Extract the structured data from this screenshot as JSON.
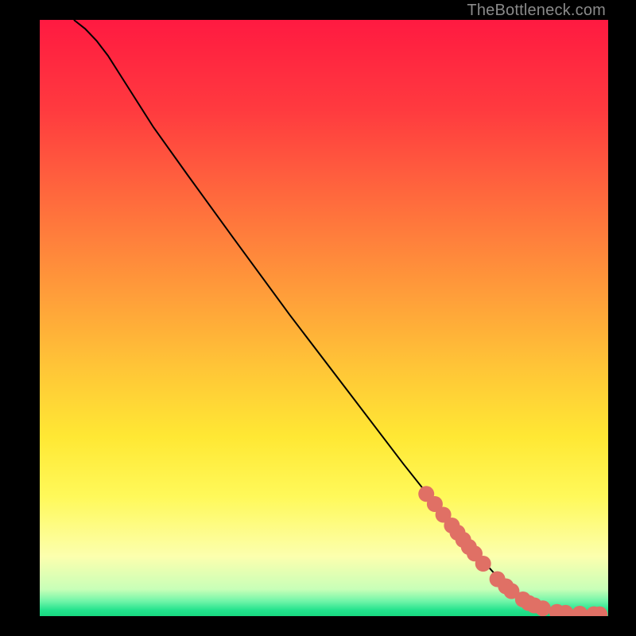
{
  "attribution": "TheBottleneck.com",
  "chart_data": {
    "type": "line",
    "title": "",
    "xlabel": "",
    "ylabel": "",
    "xlim": [
      0,
      100
    ],
    "ylim": [
      0,
      100
    ],
    "background_gradient": {
      "direction": "vertical",
      "stops": [
        {
          "pos": 0.0,
          "color": "#ff1a41"
        },
        {
          "pos": 0.15,
          "color": "#ff3a3f"
        },
        {
          "pos": 0.3,
          "color": "#ff6a3d"
        },
        {
          "pos": 0.45,
          "color": "#ff9a3a"
        },
        {
          "pos": 0.58,
          "color": "#ffc437"
        },
        {
          "pos": 0.7,
          "color": "#ffe834"
        },
        {
          "pos": 0.8,
          "color": "#fff95a"
        },
        {
          "pos": 0.9,
          "color": "#fcffae"
        },
        {
          "pos": 0.955,
          "color": "#c8ffb8"
        },
        {
          "pos": 0.975,
          "color": "#70f5a8"
        },
        {
          "pos": 0.99,
          "color": "#23e38d"
        },
        {
          "pos": 1.0,
          "color": "#18d880"
        }
      ]
    },
    "series": [
      {
        "name": "curve",
        "type": "line",
        "x": [
          6,
          8,
          10,
          12,
          14,
          16,
          20,
          26,
          34,
          44,
          54,
          64,
          74,
          82,
          86,
          88,
          90,
          92,
          94,
          96,
          98,
          99
        ],
        "y": [
          100,
          98.5,
          96.5,
          94,
          91,
          88,
          82,
          74,
          63.5,
          50.5,
          38,
          25.5,
          13.5,
          5,
          2.2,
          1.4,
          0.9,
          0.6,
          0.45,
          0.35,
          0.3,
          0.3
        ],
        "stroke": "#000000",
        "stroke_width": 2
      },
      {
        "name": "markers",
        "type": "scatter",
        "x": [
          68,
          69.5,
          71,
          72.5,
          73.5,
          74.5,
          75.5,
          76.5,
          78,
          80.5,
          82,
          83,
          85,
          86,
          87,
          88.5,
          91,
          92.5,
          95,
          97.5,
          98.5
        ],
        "y": [
          20.5,
          18.8,
          17,
          15.2,
          14,
          12.8,
          11.6,
          10.5,
          8.8,
          6.2,
          5,
          4.2,
          2.8,
          2.2,
          1.8,
          1.3,
          0.7,
          0.55,
          0.4,
          0.32,
          0.3
        ],
        "marker_color": "#e07065",
        "marker_radius": 10
      }
    ]
  }
}
